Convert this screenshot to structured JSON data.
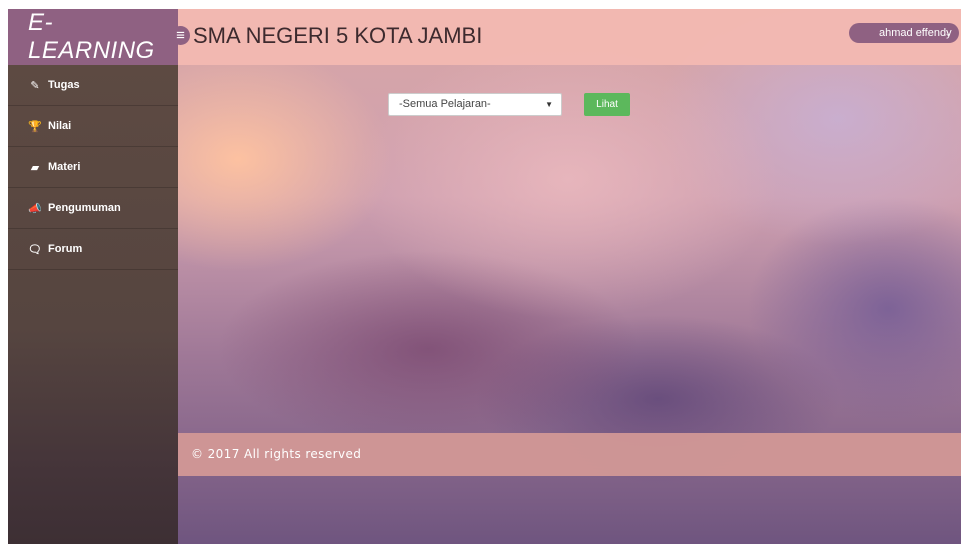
{
  "header": {
    "brand": "E-LEARNING",
    "toggle_glyph": "≡",
    "school_name": "SMA NEGERI 5 KOTA JAMBI",
    "user_name": "ahmad effendy",
    "user_caret": "⌄"
  },
  "sidebar": {
    "items": [
      {
        "label": "Tugas",
        "icon": "pencil-icon",
        "glyph": "✎"
      },
      {
        "label": "Nilai",
        "icon": "trophy-icon",
        "glyph": "🏆"
      },
      {
        "label": "Materi",
        "icon": "book-icon",
        "glyph": "▰"
      },
      {
        "label": "Pengumuman",
        "icon": "bullhorn-icon",
        "glyph": "📣"
      },
      {
        "label": "Forum",
        "icon": "comments-icon",
        "glyph": "🗨"
      }
    ]
  },
  "filter": {
    "subject_select_value": "-Semua Pelajaran-",
    "select_arrow": "▼",
    "view_button": "Lihat"
  },
  "footer": {
    "copyright": "© 2017 All rights reserved"
  },
  "colors": {
    "header": "#f3b9b2",
    "brand": "#8f6182",
    "button": "#5cb85c",
    "footer": "#d29896"
  }
}
